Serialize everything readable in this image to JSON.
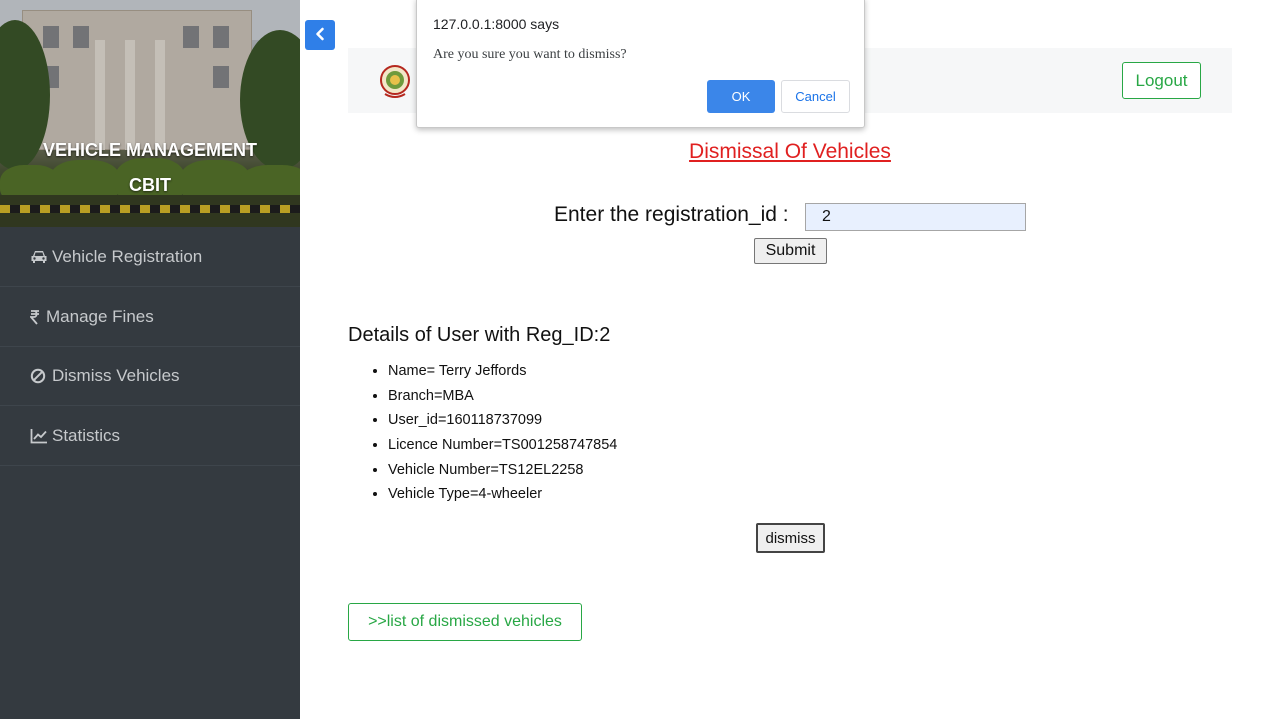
{
  "sidebar": {
    "title_line1": "VEHICLE MANAGEMENT",
    "title_line2": "CBIT",
    "items": [
      {
        "label": "Vehicle Registration",
        "icon": "car-icon"
      },
      {
        "label": "Manage Fines",
        "icon": "rupee-icon"
      },
      {
        "label": "Dismiss Vehicles",
        "icon": "ban-icon"
      },
      {
        "label": "Statistics",
        "icon": "line-chart-icon"
      }
    ]
  },
  "header": {
    "logout_label": "Logout"
  },
  "dialog": {
    "title": "127.0.0.1:8000 says",
    "message": "Are you sure you want to dismiss?",
    "ok_label": "OK",
    "cancel_label": "Cancel"
  },
  "main": {
    "heading": "Dismissal Of Vehicles",
    "reg_label": "Enter the registration_id :",
    "reg_value": "2",
    "submit_label": "Submit",
    "details_title": "Details of User with Reg_ID:2",
    "details": [
      "Name= Terry Jeffords",
      "Branch=MBA",
      "User_id=160118737099",
      "Licence Number=TS001258747854",
      "Vehicle Number=TS12EL2258",
      "Vehicle Type=4-wheeler"
    ],
    "dismiss_label": "dismiss",
    "list_link_label": ">>list of dismissed vehicles"
  },
  "colors": {
    "sidebar_bg": "#343a40",
    "accent_blue": "#2f7fe8",
    "heading_red": "#e02020",
    "success_green": "#28a745"
  }
}
